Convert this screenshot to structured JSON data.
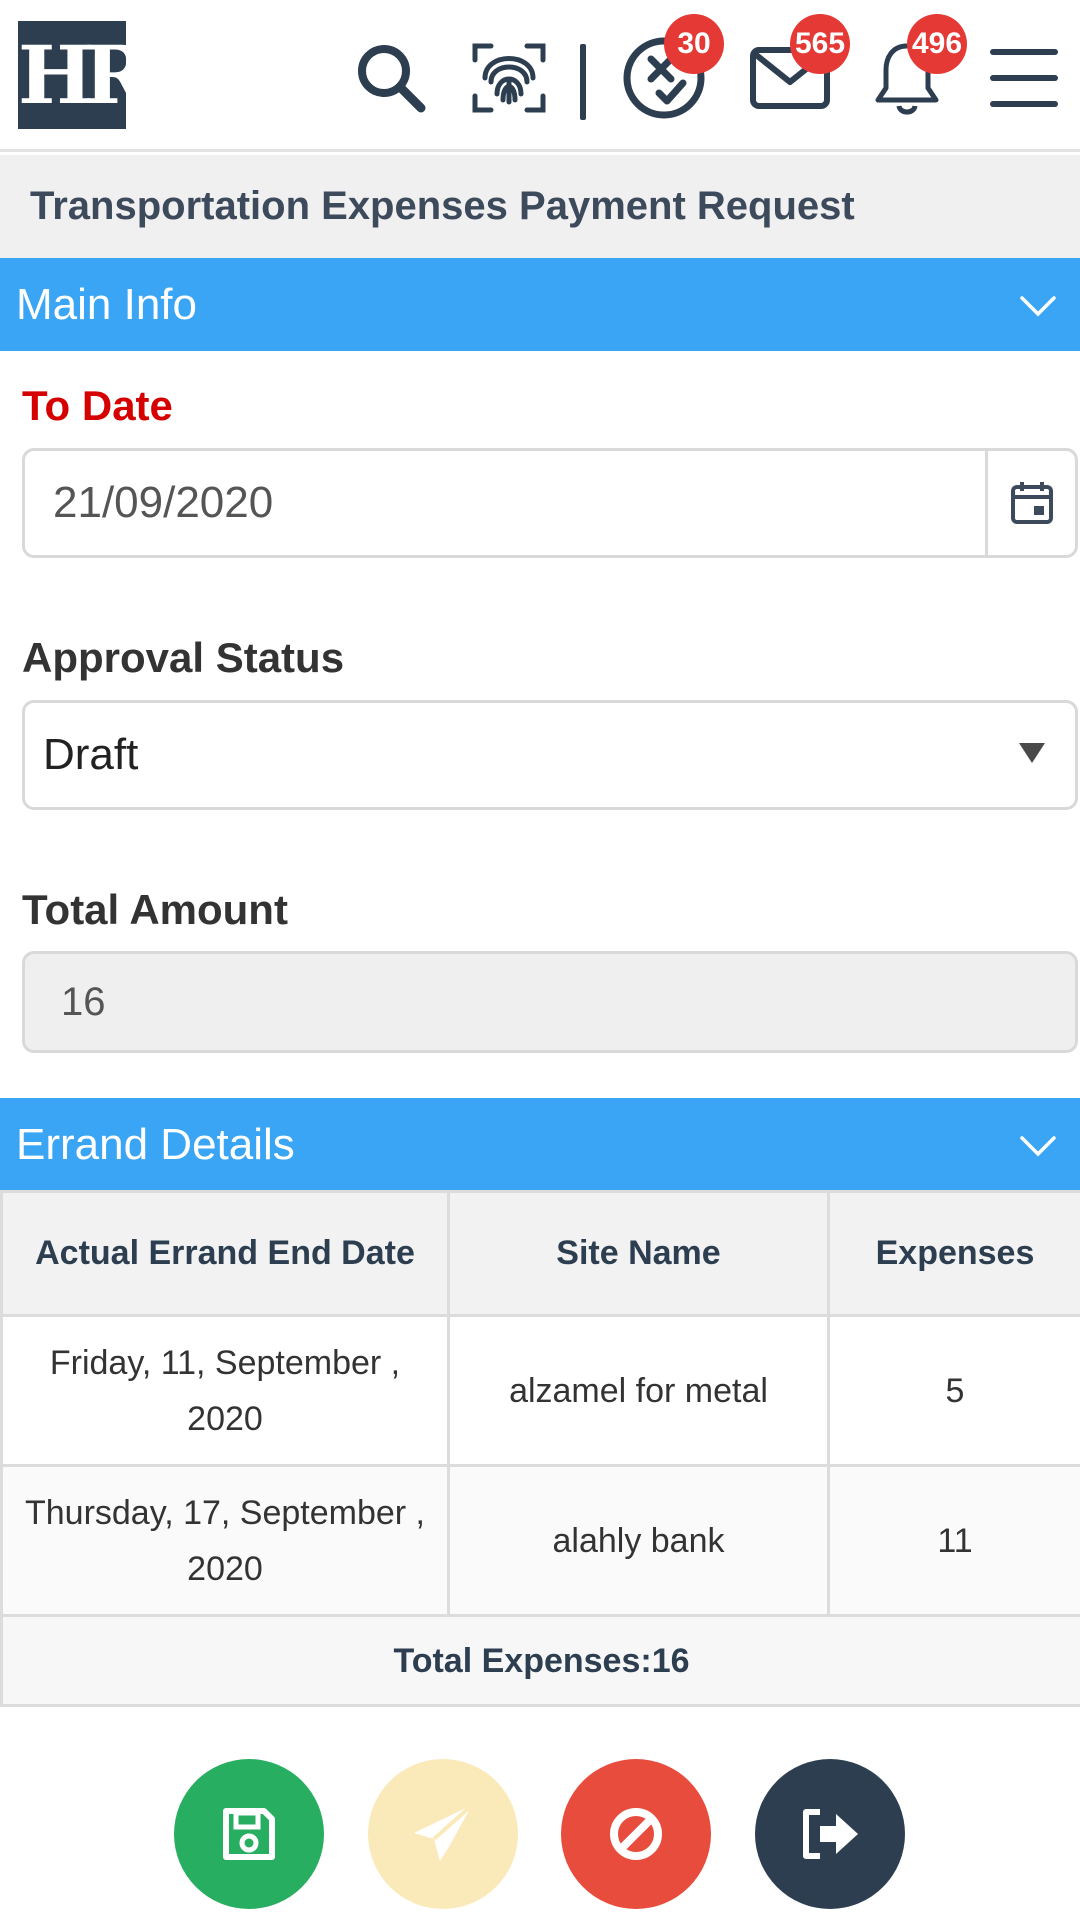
{
  "header": {
    "logo_text": "HR",
    "badges": {
      "approvals": "30",
      "messages": "565",
      "notifications": "496"
    },
    "icons": [
      "search-icon",
      "fingerprint-icon",
      "approval-icon",
      "mail-icon",
      "bell-icon",
      "menu-icon"
    ]
  },
  "page": {
    "title": "Transportation Expenses Payment Request"
  },
  "main_info": {
    "title": "Main Info",
    "to_date": {
      "label": "To Date",
      "value": "21/09/2020"
    },
    "approval_status": {
      "label": "Approval Status",
      "value": "Draft"
    },
    "total_amount": {
      "label": "Total Amount",
      "value": "16"
    }
  },
  "errand_details": {
    "title": "Errand Details",
    "columns": [
      "Actual Errand End Date",
      "Site Name",
      "Expenses"
    ],
    "rows": [
      {
        "date_line1": "Friday, 11, September ,",
        "date_line2": "2020",
        "site": "alzamel for metal",
        "expenses": "5"
      },
      {
        "date_line1": "Thursday, 17, September ,",
        "date_line2": "2020",
        "site": "alahly bank",
        "expenses": "11"
      }
    ],
    "total": "Total Expenses:16"
  },
  "colors": {
    "section_header": "#3ba5f5",
    "required_label": "#d50000",
    "save": "#27ae60",
    "send": "#faeaba",
    "cancel": "#e74c3c",
    "exit": "#2c3e50",
    "badge": "#e53935"
  },
  "actions": [
    "save-icon",
    "send-icon",
    "cancel-icon",
    "exit-icon"
  ]
}
